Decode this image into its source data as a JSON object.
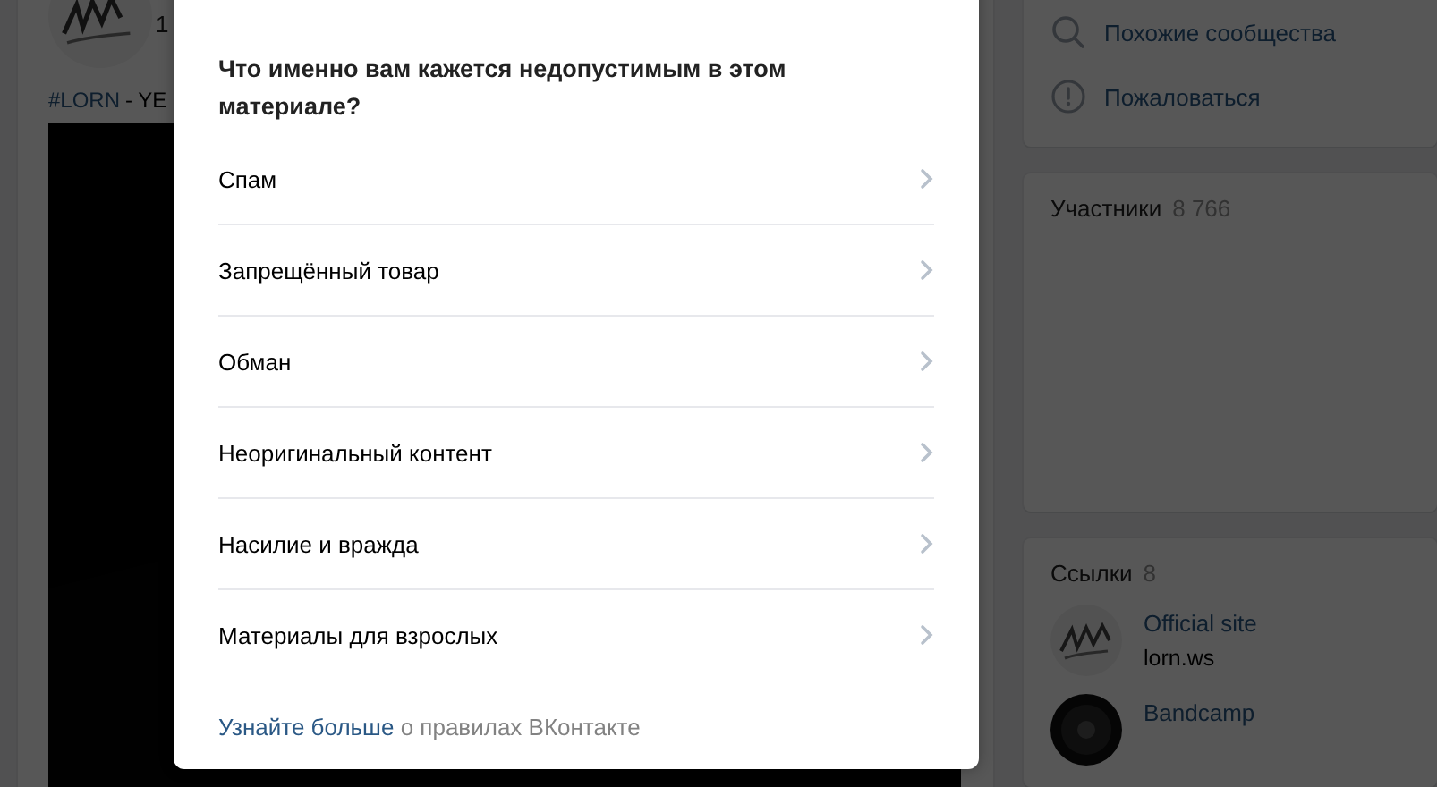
{
  "post": {
    "counter": "1",
    "hashtag": "#LORN",
    "title": "- YE"
  },
  "side_menu": [
    {
      "kind": "search",
      "label": "Похожие сообщества"
    },
    {
      "kind": "report",
      "label": "Пожаловаться"
    }
  ],
  "members": {
    "title": "Участники",
    "count": "8 766"
  },
  "links": {
    "title": "Ссылки",
    "count": "8",
    "items": [
      {
        "kind": "logo",
        "title": "Official site",
        "subtitle": "lorn.ws"
      },
      {
        "kind": "disc",
        "title": "Bandcamp"
      }
    ]
  },
  "report_dialog": {
    "question": "Что именно вам кажется недопустимым в этом материале?",
    "options": [
      "Спам",
      "Запрещённый товар",
      "Обман",
      "Неоригинальный контент",
      "Насилие и вражда",
      "Материалы для взрослых"
    ],
    "footer_link": "Узнайте больше",
    "footer_text": "о правилах ВКонтакте"
  }
}
